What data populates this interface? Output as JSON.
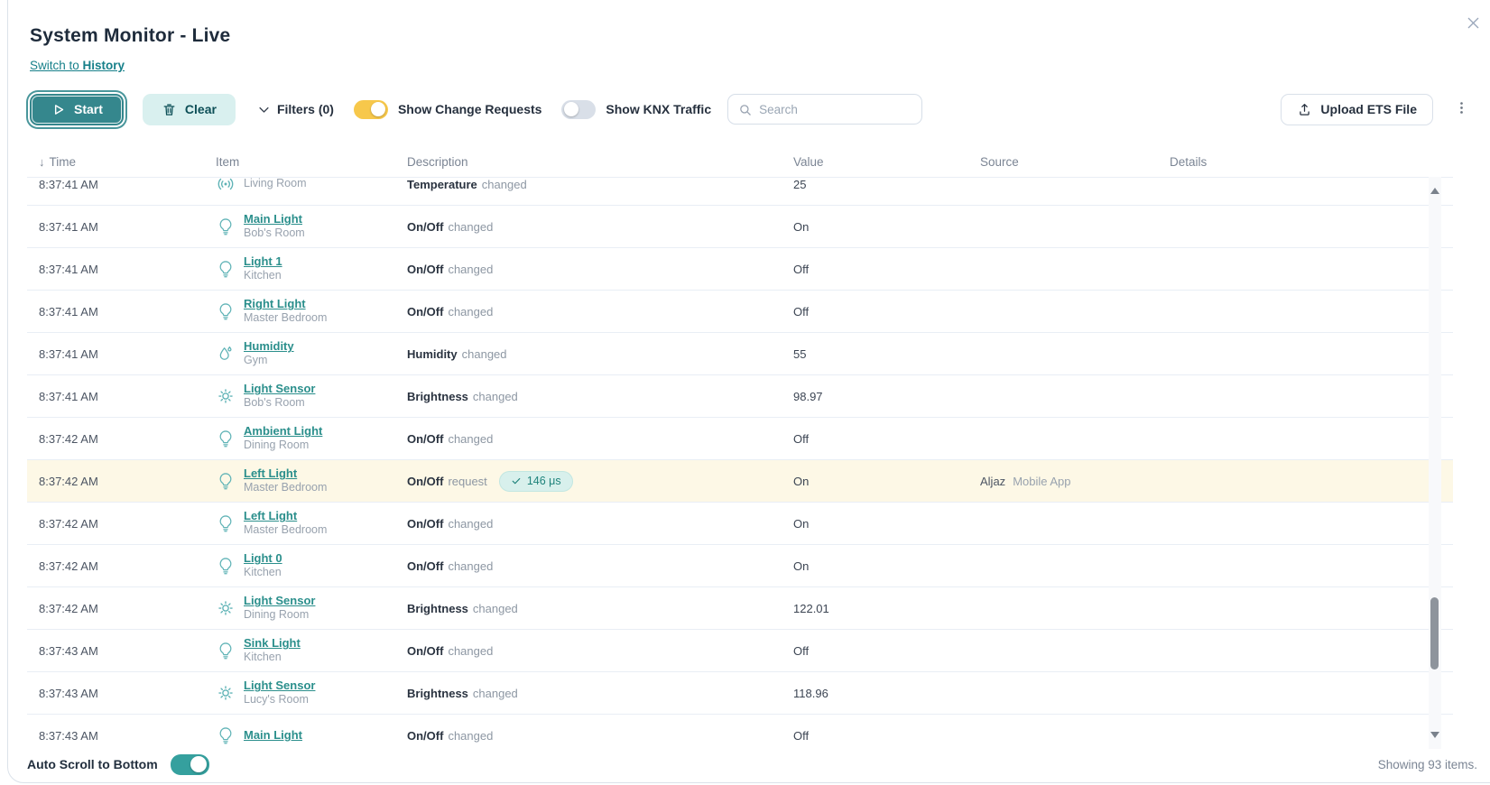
{
  "header": {
    "title": "System Monitor - Live",
    "switch_prefix": "Switch to ",
    "switch_bold": "History"
  },
  "toolbar": {
    "start_label": "Start",
    "clear_label": "Clear",
    "filters_label": "Filters (0)",
    "toggle_change_requests": {
      "label": "Show Change Requests",
      "on": true
    },
    "toggle_knx_traffic": {
      "label": "Show KNX Traffic",
      "on": false
    },
    "search_placeholder": "Search",
    "upload_label": "Upload ETS File"
  },
  "table": {
    "columns": [
      "Time",
      "Item",
      "Description",
      "Value",
      "Source",
      "Details"
    ],
    "rows": [
      {
        "time": "8:37:41 AM",
        "icon": "broadcast",
        "item": "",
        "room": "Living Room",
        "desc_main": "Temperature",
        "desc_sub": "changed",
        "value": "25"
      },
      {
        "time": "8:37:41 AM",
        "icon": "bulb",
        "item": "Main Light",
        "room": "Bob's Room",
        "desc_main": "On/Off",
        "desc_sub": "changed",
        "value": "On"
      },
      {
        "time": "8:37:41 AM",
        "icon": "bulb",
        "item": "Light 1",
        "room": "Kitchen",
        "desc_main": "On/Off",
        "desc_sub": "changed",
        "value": "Off"
      },
      {
        "time": "8:37:41 AM",
        "icon": "bulb",
        "item": "Right Light",
        "room": "Master Bedroom",
        "desc_main": "On/Off",
        "desc_sub": "changed",
        "value": "Off"
      },
      {
        "time": "8:37:41 AM",
        "icon": "droplet",
        "item": "Humidity",
        "room": "Gym",
        "desc_main": "Humidity",
        "desc_sub": "changed",
        "value": "55"
      },
      {
        "time": "8:37:41 AM",
        "icon": "sun",
        "item": "Light Sensor",
        "room": "Bob's Room",
        "desc_main": "Brightness",
        "desc_sub": "changed",
        "value": "98.97"
      },
      {
        "time": "8:37:42 AM",
        "icon": "bulb",
        "item": "Ambient Light",
        "room": "Dining Room",
        "desc_main": "On/Off",
        "desc_sub": "changed",
        "value": "Off"
      },
      {
        "time": "8:37:42 AM",
        "icon": "bulb",
        "item": "Left Light",
        "room": "Master Bedroom",
        "desc_main": "On/Off",
        "desc_sub": "request",
        "badge": "146 μs",
        "value": "On",
        "source_user": "Aljaz",
        "source_app": "Mobile App",
        "highlighted": true
      },
      {
        "time": "8:37:42 AM",
        "icon": "bulb",
        "item": "Left Light",
        "room": "Master Bedroom",
        "desc_main": "On/Off",
        "desc_sub": "changed",
        "value": "On"
      },
      {
        "time": "8:37:42 AM",
        "icon": "bulb",
        "item": "Light 0",
        "room": "Kitchen",
        "desc_main": "On/Off",
        "desc_sub": "changed",
        "value": "On"
      },
      {
        "time": "8:37:42 AM",
        "icon": "sun",
        "item": "Light Sensor",
        "room": "Dining Room",
        "desc_main": "Brightness",
        "desc_sub": "changed",
        "value": "122.01"
      },
      {
        "time": "8:37:43 AM",
        "icon": "bulb",
        "item": "Sink Light",
        "room": "Kitchen",
        "desc_main": "On/Off",
        "desc_sub": "changed",
        "value": "Off"
      },
      {
        "time": "8:37:43 AM",
        "icon": "sun",
        "item": "Light Sensor",
        "room": "Lucy's Room",
        "desc_main": "Brightness",
        "desc_sub": "changed",
        "value": "118.96"
      },
      {
        "time": "8:37:43 AM",
        "icon": "bulb",
        "item": "Main Light",
        "room": "",
        "desc_main": "On/Off",
        "desc_sub": "changed",
        "value": "Off"
      }
    ]
  },
  "footer": {
    "autoscroll_label": "Auto Scroll to Bottom",
    "autoscroll_on": true,
    "items_count": "Showing 93 items."
  },
  "colors": {
    "accent_teal": "#35878d",
    "toggle_yellow": "#f7c84b",
    "highlight_row": "#fdf8e6",
    "badge_bg": "#d8f0ec",
    "badge_text": "#1f837b",
    "link_teal": "#2b8f8c"
  }
}
